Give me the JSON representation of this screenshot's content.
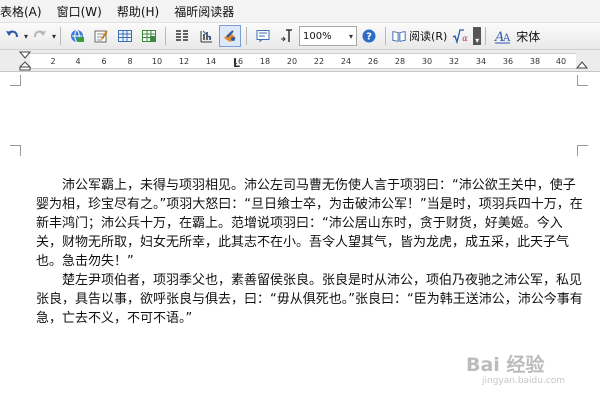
{
  "menu": [
    "表格(A)",
    "窗口(W)",
    "帮助(H)",
    "福昕阅读器"
  ],
  "toolbar": {
    "zoom": "100%",
    "read_label": "阅读(R)",
    "font_name": "宋体"
  },
  "ruler": {
    "numbers": [
      "2",
      "4",
      "6",
      "8",
      "10",
      "12",
      "14",
      "16",
      "18",
      "20",
      "22",
      "24",
      "26",
      "28",
      "30",
      "32",
      "34",
      "36",
      "38",
      "40"
    ]
  },
  "document": {
    "paragraphs": [
      "沛公军霸上，未得与项羽相见。沛公左司马曹无伤使人言于项羽曰：“沛公欲王关中，使子婴为相，珍宝尽有之。”项羽大怒曰：“旦日飨士卒，为击破沛公军！”当是时，项羽兵四十万，在新丰鸿门；沛公兵十万，在霸上。范增说项羽曰：“沛公居山东时，贪于财货，好美姬。今入关，财物无所取，妇女无所幸，此其志不在小。吾令人望其气，皆为龙虎，成五采，此天子气也。急击勿失！”",
      "楚左尹项伯者，项羽季父也，素善留侯张良。张良是时从沛公，项伯乃夜驰之沛公军，私见张良，具告以事，欲呼张良与俱去，曰：“毋从俱死也。”张良曰：“臣为韩王送沛公，沛公今事有急，亡去不义，不可不语。”"
    ]
  },
  "watermark": {
    "logo": "Bai 经验",
    "url": "jingyan.baidu.com"
  }
}
